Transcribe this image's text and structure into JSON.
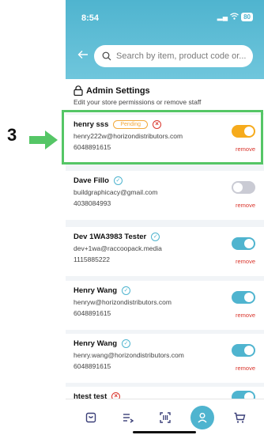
{
  "annotation": {
    "step_number": "3",
    "arrow_color": "#55c666",
    "highlight_color": "#55c666"
  },
  "status_bar": {
    "time": "8:54",
    "battery": "80"
  },
  "search": {
    "placeholder": "Search by item, product code or..."
  },
  "settings": {
    "title": "Admin Settings",
    "subtitle": "Edit your store permissions or remove staff"
  },
  "staff": [
    {
      "name": "henry sss",
      "badge": "Pending",
      "email": "henry222w@horizondistributors.com",
      "phone": "6048891615",
      "toggle": "pending",
      "remove": "remove"
    },
    {
      "name": "Dave Fillo",
      "email": "buildgraphicacy@gmail.com",
      "phone": "4038084993",
      "toggle": "inactive",
      "remove": "remove"
    },
    {
      "name": "Dev 1WA3983 Tester",
      "email": "dev+1wa@raccoopack.media",
      "phone": "1115885222",
      "toggle": "active",
      "remove": "remove"
    },
    {
      "name": "Henry Wang",
      "email": "henryw@horizondistributors.com",
      "phone": "6048891615",
      "toggle": "active",
      "remove": "remove"
    },
    {
      "name": "Henry Wang",
      "email": "henry.wang@horizondistributors.com",
      "phone": "6048891615",
      "toggle": "active",
      "remove": "remove"
    },
    {
      "name": "htest test",
      "toggle": "active"
    }
  ],
  "bottom_nav": [
    "bag-icon",
    "list-add-icon",
    "barcode-scan-icon",
    "profile-icon",
    "cart-icon"
  ],
  "colors": {
    "brand": "#4fb4cf",
    "pending": "#f6ab1c",
    "danger": "#d9342b"
  }
}
